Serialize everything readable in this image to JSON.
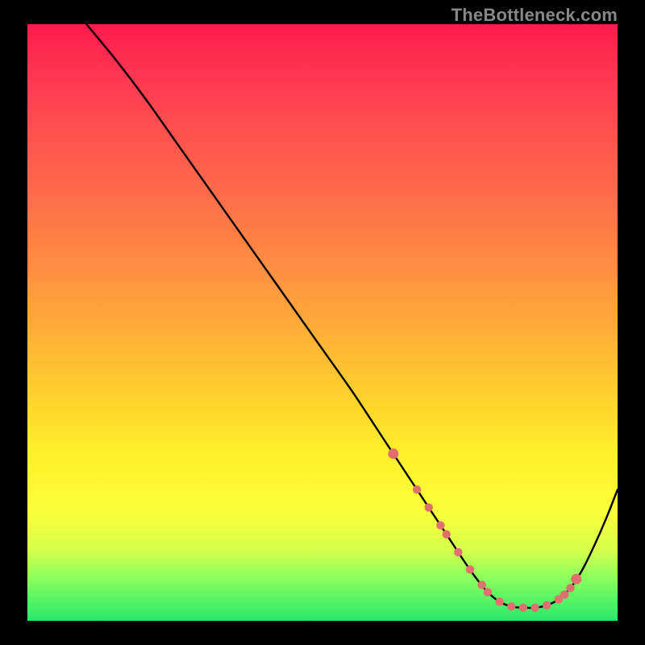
{
  "watermark": "TheBottleneck.com",
  "chart_data": {
    "type": "line",
    "title": "",
    "xlabel": "",
    "ylabel": "",
    "xlim": [
      0,
      100
    ],
    "ylim": [
      0,
      100
    ],
    "grid": false,
    "series": [
      {
        "name": "curve",
        "color": "#000000",
        "x": [
          10,
          15,
          20,
          25,
          30,
          35,
          40,
          45,
          50,
          55,
          60,
          62,
          64,
          66,
          68,
          70,
          72,
          74,
          76,
          78,
          80,
          82,
          84,
          86,
          88,
          90,
          92,
          94,
          96,
          98,
          100
        ],
        "values": [
          100,
          94,
          87.5,
          80.5,
          73.5,
          66.5,
          59.5,
          52.5,
          45.5,
          38.5,
          31,
          28,
          25,
          22,
          19,
          16,
          13,
          10,
          7.2,
          4.8,
          3.2,
          2.4,
          2.2,
          2.2,
          2.6,
          3.6,
          5.5,
          8.5,
          12.5,
          17,
          22
        ]
      },
      {
        "name": "markers",
        "color": "#e07070",
        "x": [
          62,
          66,
          68,
          70,
          71,
          73,
          75,
          77,
          78,
          80,
          82,
          84,
          86,
          88,
          90,
          91,
          92,
          93
        ],
        "values": [
          28,
          22,
          19,
          16,
          14.5,
          11.5,
          8.6,
          6,
          4.8,
          3.2,
          2.4,
          2.2,
          2.2,
          2.6,
          3.6,
          4.4,
          5.5,
          7
        ]
      }
    ],
    "legend": false
  },
  "gradient_stops": [
    {
      "pos": 0,
      "color": "#ff1a4d"
    },
    {
      "pos": 10,
      "color": "#ff3b52"
    },
    {
      "pos": 28,
      "color": "#ff6a4a"
    },
    {
      "pos": 45,
      "color": "#ff9a3f"
    },
    {
      "pos": 60,
      "color": "#ffc92e"
    },
    {
      "pos": 72,
      "color": "#fff02a"
    },
    {
      "pos": 82,
      "color": "#f9ff3a"
    },
    {
      "pos": 88,
      "color": "#d8ff4a"
    },
    {
      "pos": 93,
      "color": "#88ff5e"
    },
    {
      "pos": 100,
      "color": "#27e86b"
    }
  ]
}
